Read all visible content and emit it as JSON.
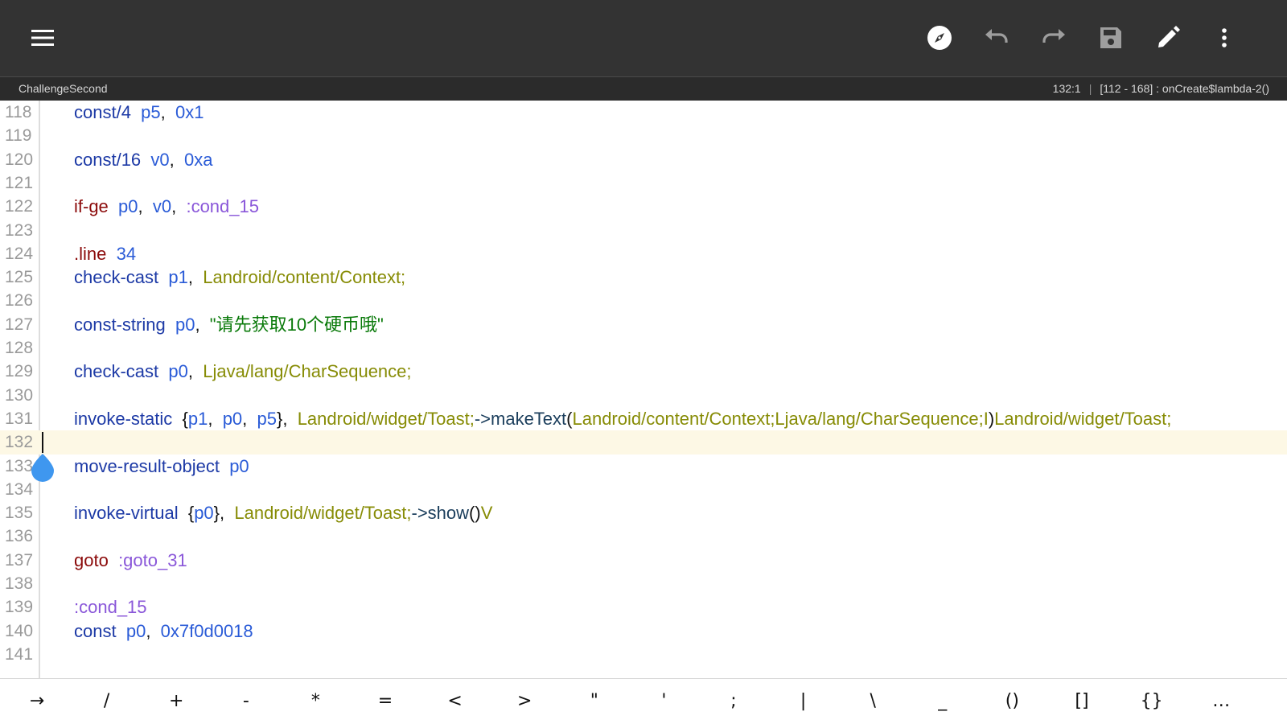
{
  "toolbar": {
    "icons": [
      "menu-icon",
      "compass-icon",
      "undo-icon",
      "redo-icon",
      "save-icon",
      "edit-icon",
      "more-icon"
    ]
  },
  "status": {
    "file_name": "ChallengeSecond",
    "cursor": "132:1",
    "range": "[112 - 168] : onCreate$lambda-2()"
  },
  "editor": {
    "current_line": "132",
    "lines": [
      {
        "num": "118",
        "t": [
          [
            "kw",
            "const/4"
          ],
          [
            "pun",
            "  "
          ],
          [
            "reg",
            "p5"
          ],
          [
            "pun",
            ",  "
          ],
          [
            "reg",
            "0x1"
          ]
        ]
      },
      {
        "num": "119",
        "t": []
      },
      {
        "num": "120",
        "t": [
          [
            "kw",
            "const/16"
          ],
          [
            "pun",
            "  "
          ],
          [
            "reg",
            "v0"
          ],
          [
            "pun",
            ",  "
          ],
          [
            "reg",
            "0xa"
          ]
        ]
      },
      {
        "num": "121",
        "t": []
      },
      {
        "num": "122",
        "t": [
          [
            "op",
            "if-ge"
          ],
          [
            "pun",
            "  "
          ],
          [
            "reg",
            "p0"
          ],
          [
            "pun",
            ",  "
          ],
          [
            "reg",
            "v0"
          ],
          [
            "pun",
            ",  "
          ],
          [
            "lbl",
            ":cond_15"
          ]
        ]
      },
      {
        "num": "123",
        "t": []
      },
      {
        "num": "124",
        "t": [
          [
            "op",
            ".line"
          ],
          [
            "pun",
            "  "
          ],
          [
            "reg",
            "34"
          ]
        ]
      },
      {
        "num": "125",
        "t": [
          [
            "kw",
            "check-cast"
          ],
          [
            "pun",
            "  "
          ],
          [
            "reg",
            "p1"
          ],
          [
            "pun",
            ",  "
          ],
          [
            "cls",
            "Landroid/content/Context;"
          ]
        ]
      },
      {
        "num": "126",
        "t": []
      },
      {
        "num": "127",
        "t": [
          [
            "kw",
            "const-string"
          ],
          [
            "pun",
            "  "
          ],
          [
            "reg",
            "p0"
          ],
          [
            "pun",
            ",  "
          ],
          [
            "str",
            "\"请先获取10个硬币哦\""
          ]
        ]
      },
      {
        "num": "128",
        "t": []
      },
      {
        "num": "129",
        "t": [
          [
            "kw",
            "check-cast"
          ],
          [
            "pun",
            "  "
          ],
          [
            "reg",
            "p0"
          ],
          [
            "pun",
            ",  "
          ],
          [
            "cls",
            "Ljava/lang/CharSequence;"
          ]
        ]
      },
      {
        "num": "130",
        "t": []
      },
      {
        "num": "131",
        "t": [
          [
            "kw",
            "invoke-static"
          ],
          [
            "pun",
            "  {"
          ],
          [
            "reg",
            "p1"
          ],
          [
            "pun",
            ",  "
          ],
          [
            "reg",
            "p0"
          ],
          [
            "pun",
            ",  "
          ],
          [
            "reg",
            "p5"
          ],
          [
            "pun",
            "},  "
          ],
          [
            "cls",
            "Landroid/widget/Toast;"
          ],
          [
            "mth",
            "->makeText"
          ],
          [
            "pun",
            "("
          ],
          [
            "cls",
            "Landroid/content/Context;Ljava/lang/CharSequence;I"
          ],
          [
            "pun",
            ")"
          ],
          [
            "cls",
            "Landroid/widget/Toast;"
          ]
        ]
      },
      {
        "num": "132",
        "t": []
      },
      {
        "num": "133",
        "t": [
          [
            "kw",
            "move-result-object"
          ],
          [
            "pun",
            "  "
          ],
          [
            "reg",
            "p0"
          ]
        ]
      },
      {
        "num": "134",
        "t": []
      },
      {
        "num": "135",
        "t": [
          [
            "kw",
            "invoke-virtual"
          ],
          [
            "pun",
            "  {"
          ],
          [
            "reg",
            "p0"
          ],
          [
            "pun",
            "},  "
          ],
          [
            "cls",
            "Landroid/widget/Toast;"
          ],
          [
            "mth",
            "->show"
          ],
          [
            "pun",
            "()"
          ],
          [
            "cls",
            "V"
          ]
        ]
      },
      {
        "num": "136",
        "t": []
      },
      {
        "num": "137",
        "t": [
          [
            "op",
            "goto"
          ],
          [
            "pun",
            "  "
          ],
          [
            "lbl",
            ":goto_31"
          ]
        ]
      },
      {
        "num": "138",
        "t": []
      },
      {
        "num": "139",
        "t": [
          [
            "lbl",
            ":cond_15"
          ]
        ]
      },
      {
        "num": "140",
        "t": [
          [
            "kw",
            "const"
          ],
          [
            "pun",
            "  "
          ],
          [
            "reg",
            "p0"
          ],
          [
            "pun",
            ",  "
          ],
          [
            "reg",
            "0x7f0d0018"
          ]
        ]
      },
      {
        "num": "141",
        "t": []
      }
    ]
  },
  "keys": [
    "→",
    "/",
    "+",
    "-",
    "*",
    "=",
    "<",
    ">",
    "\"",
    "'",
    ";",
    "|",
    "\\",
    "_",
    "()",
    "[]",
    "{}",
    "…"
  ]
}
